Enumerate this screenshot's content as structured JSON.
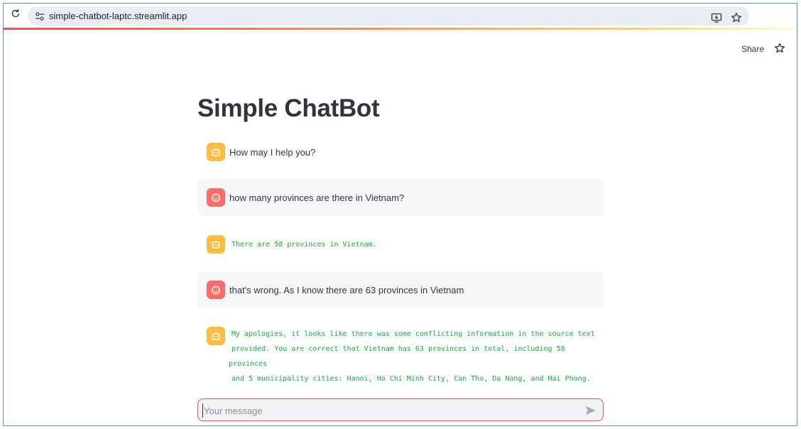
{
  "browser": {
    "url": "simple-chatbot-laptc.streamlit.app"
  },
  "header": {
    "share_label": "Share"
  },
  "page": {
    "title": "Simple ChatBot"
  },
  "messages": [
    {
      "role": "assistant",
      "text": "How may I help you?"
    },
    {
      "role": "user",
      "text": "how many provinces are there in Vietnam?"
    },
    {
      "role": "assistant",
      "code_lines": [
        "There are 58 provinces in Vietnam."
      ]
    },
    {
      "role": "user",
      "text": "that's wrong. As I know there are 63 provinces in Vietnam"
    },
    {
      "role": "assistant",
      "code_lines": [
        "My apologies, it looks like there was some conflicting information in the source text",
        "provided. You are correct that Vietnam has 63 provinces in total, including 58 provinces",
        "and 5 municipality cities: Hanoi, Ho Chi Minh City, Can Tho, Da Nang, and Hai Phong."
      ]
    }
  ],
  "chat_input": {
    "placeholder": "Your message"
  },
  "colors": {
    "primary": "#ff4b4b",
    "bot_avatar": "#fbbd41",
    "user_avatar": "#ff6b6b",
    "code_text": "#28a745"
  }
}
